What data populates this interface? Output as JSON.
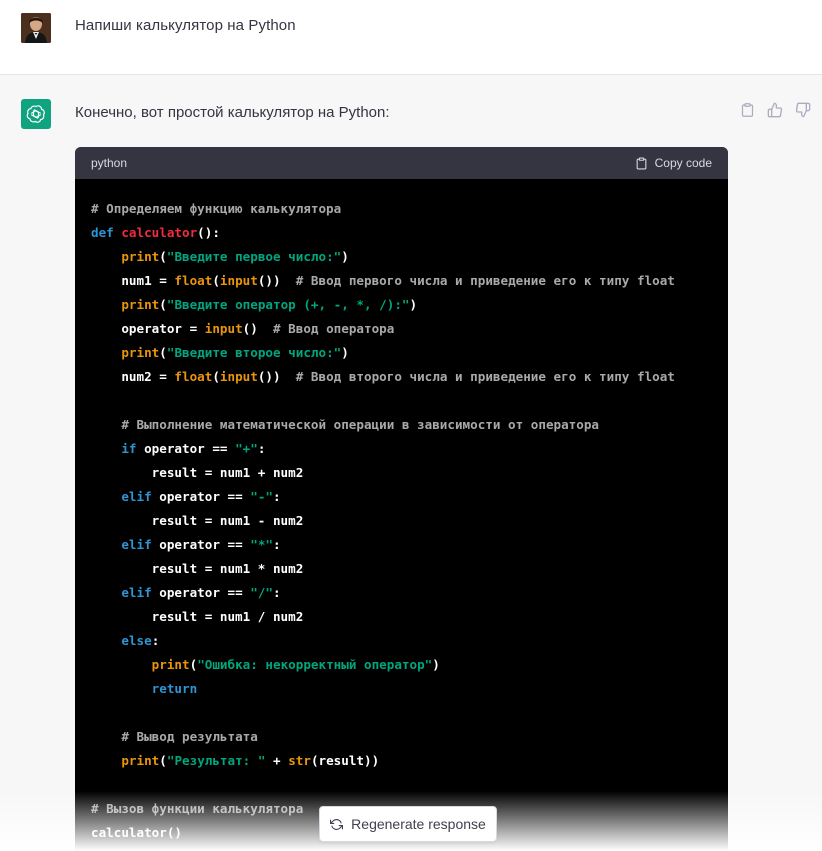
{
  "user_message": {
    "text": "Напиши калькулятор на Python",
    "avatar": "user-photo"
  },
  "assistant_message": {
    "text": "Конечно, вот простой калькулятор на Python:",
    "avatar": "openai-logo-icon",
    "avatar_color": "#10a37f",
    "actions": [
      "clipboard-icon",
      "thumbs-up-icon",
      "thumbs-down-icon"
    ]
  },
  "code_block": {
    "language": "python",
    "copy_label": "Copy code",
    "lines": [
      [
        {
          "t": "comment",
          "v": "# Определяем функцию калькулятора"
        }
      ],
      [
        {
          "t": "kw",
          "v": "def "
        },
        {
          "t": "fn",
          "v": "calculator"
        },
        {
          "t": "plain",
          "v": "():"
        }
      ],
      [
        {
          "t": "plain",
          "v": "    "
        },
        {
          "t": "builtin",
          "v": "print"
        },
        {
          "t": "plain",
          "v": "("
        },
        {
          "t": "str",
          "v": "\"Введите первое число:\""
        },
        {
          "t": "plain",
          "v": ")"
        }
      ],
      [
        {
          "t": "plain",
          "v": "    num1 = "
        },
        {
          "t": "builtin",
          "v": "float"
        },
        {
          "t": "plain",
          "v": "("
        },
        {
          "t": "builtin",
          "v": "input"
        },
        {
          "t": "plain",
          "v": "())  "
        },
        {
          "t": "comment",
          "v": "# Ввод первого числа и приведение его к типу float"
        }
      ],
      [
        {
          "t": "plain",
          "v": "    "
        },
        {
          "t": "builtin",
          "v": "print"
        },
        {
          "t": "plain",
          "v": "("
        },
        {
          "t": "str",
          "v": "\"Введите оператор (+, -, *, /):\""
        },
        {
          "t": "plain",
          "v": ")"
        }
      ],
      [
        {
          "t": "plain",
          "v": "    operator = "
        },
        {
          "t": "builtin",
          "v": "input"
        },
        {
          "t": "plain",
          "v": "()  "
        },
        {
          "t": "comment",
          "v": "# Ввод оператора"
        }
      ],
      [
        {
          "t": "plain",
          "v": "    "
        },
        {
          "t": "builtin",
          "v": "print"
        },
        {
          "t": "plain",
          "v": "("
        },
        {
          "t": "str",
          "v": "\"Введите второе число:\""
        },
        {
          "t": "plain",
          "v": ")"
        }
      ],
      [
        {
          "t": "plain",
          "v": "    num2 = "
        },
        {
          "t": "builtin",
          "v": "float"
        },
        {
          "t": "plain",
          "v": "("
        },
        {
          "t": "builtin",
          "v": "input"
        },
        {
          "t": "plain",
          "v": "())  "
        },
        {
          "t": "comment",
          "v": "# Ввод второго числа и приведение его к типу float"
        }
      ],
      [],
      [
        {
          "t": "plain",
          "v": "    "
        },
        {
          "t": "comment",
          "v": "# Выполнение математической операции в зависимости от оператора"
        }
      ],
      [
        {
          "t": "plain",
          "v": "    "
        },
        {
          "t": "kw",
          "v": "if"
        },
        {
          "t": "plain",
          "v": " operator == "
        },
        {
          "t": "str",
          "v": "\"+\""
        },
        {
          "t": "plain",
          "v": ":"
        }
      ],
      [
        {
          "t": "plain",
          "v": "        result = num1 + num2"
        }
      ],
      [
        {
          "t": "plain",
          "v": "    "
        },
        {
          "t": "kw",
          "v": "elif"
        },
        {
          "t": "plain",
          "v": " operator == "
        },
        {
          "t": "str",
          "v": "\"-\""
        },
        {
          "t": "plain",
          "v": ":"
        }
      ],
      [
        {
          "t": "plain",
          "v": "        result = num1 - num2"
        }
      ],
      [
        {
          "t": "plain",
          "v": "    "
        },
        {
          "t": "kw",
          "v": "elif"
        },
        {
          "t": "plain",
          "v": " operator == "
        },
        {
          "t": "str",
          "v": "\"*\""
        },
        {
          "t": "plain",
          "v": ":"
        }
      ],
      [
        {
          "t": "plain",
          "v": "        result = num1 * num2"
        }
      ],
      [
        {
          "t": "plain",
          "v": "    "
        },
        {
          "t": "kw",
          "v": "elif"
        },
        {
          "t": "plain",
          "v": " operator == "
        },
        {
          "t": "str",
          "v": "\"/\""
        },
        {
          "t": "plain",
          "v": ":"
        }
      ],
      [
        {
          "t": "plain",
          "v": "        result = num1 / num2"
        }
      ],
      [
        {
          "t": "plain",
          "v": "    "
        },
        {
          "t": "kw",
          "v": "else"
        },
        {
          "t": "plain",
          "v": ":"
        }
      ],
      [
        {
          "t": "plain",
          "v": "        "
        },
        {
          "t": "builtin",
          "v": "print"
        },
        {
          "t": "plain",
          "v": "("
        },
        {
          "t": "str",
          "v": "\"Ошибка: некорректный оператор\""
        },
        {
          "t": "plain",
          "v": ")"
        }
      ],
      [
        {
          "t": "plain",
          "v": "        "
        },
        {
          "t": "kw",
          "v": "return"
        }
      ],
      [],
      [
        {
          "t": "plain",
          "v": "    "
        },
        {
          "t": "comment",
          "v": "# Вывод результата"
        }
      ],
      [
        {
          "t": "plain",
          "v": "    "
        },
        {
          "t": "builtin",
          "v": "print"
        },
        {
          "t": "plain",
          "v": "("
        },
        {
          "t": "str",
          "v": "\"Результат: \""
        },
        {
          "t": "plain",
          "v": " + "
        },
        {
          "t": "builtin",
          "v": "str"
        },
        {
          "t": "plain",
          "v": "(result))"
        }
      ],
      [],
      [
        {
          "t": "comment",
          "v": "# Вызов функции калькулятора"
        }
      ],
      [
        {
          "t": "plain",
          "v": "calculator()"
        }
      ]
    ]
  },
  "regenerate_button": {
    "label": "Regenerate response",
    "icon": "refresh-icon"
  },
  "colors": {
    "code_bg": "#000000",
    "code_header_bg": "#343541",
    "keyword": "#2e95d3",
    "function": "#f22c3d",
    "builtin": "#e9950c",
    "string": "#00a67d",
    "comment": "#a9a9a9"
  }
}
